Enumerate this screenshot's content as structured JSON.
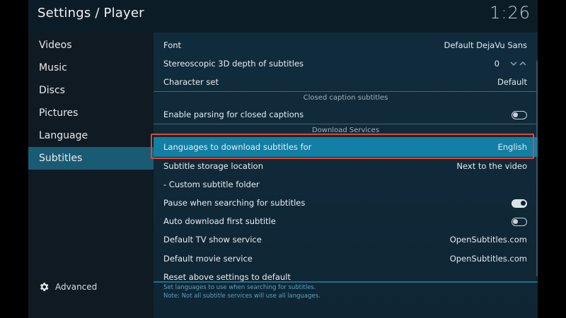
{
  "header": {
    "title": "Settings / Player",
    "clock": "1:26"
  },
  "sidebar": {
    "items": [
      {
        "label": "Videos"
      },
      {
        "label": "Music"
      },
      {
        "label": "Discs"
      },
      {
        "label": "Pictures"
      },
      {
        "label": "Language"
      },
      {
        "label": "Subtitles"
      }
    ],
    "active_index": 5,
    "advanced_label": "Advanced"
  },
  "settings": {
    "font": {
      "label": "Font",
      "value": "Default DejaVu Sans"
    },
    "stereo": {
      "label": "Stereoscopic 3D depth of subtitles",
      "value": "0"
    },
    "charset": {
      "label": "Character set",
      "value": "Default"
    },
    "section_cc": "Closed caption subtitles",
    "cc_parse": {
      "label": "Enable parsing for closed captions",
      "value": "off"
    },
    "section_dl": "Download Services",
    "languages": {
      "label": "Languages to download subtitles for",
      "value": "English"
    },
    "storage": {
      "label": "Subtitle storage location",
      "value": "Next to the video"
    },
    "custom_folder": {
      "label": "- Custom subtitle folder"
    },
    "pause": {
      "label": "Pause when searching for subtitles",
      "value": "on"
    },
    "auto_dl": {
      "label": "Auto download first subtitle",
      "value": "off"
    },
    "tv_service": {
      "label": "Default TV show service",
      "value": "OpenSubtitles.com"
    },
    "movie_service": {
      "label": "Default movie service",
      "value": "OpenSubtitles.com"
    },
    "reset": {
      "label": "Reset above settings to default"
    }
  },
  "footer": {
    "line1": "Set languages to use when searching for subtitles.",
    "line2": "Note: Not all subtitle services will use all languages."
  },
  "colors": {
    "accent": "#127fa4",
    "selection_outline": "#e2482f",
    "active_sidebar": "#1a5b74"
  },
  "icons": {
    "advanced": "gear-icon",
    "stereo_spinner": "chevron-up-down-icon"
  }
}
